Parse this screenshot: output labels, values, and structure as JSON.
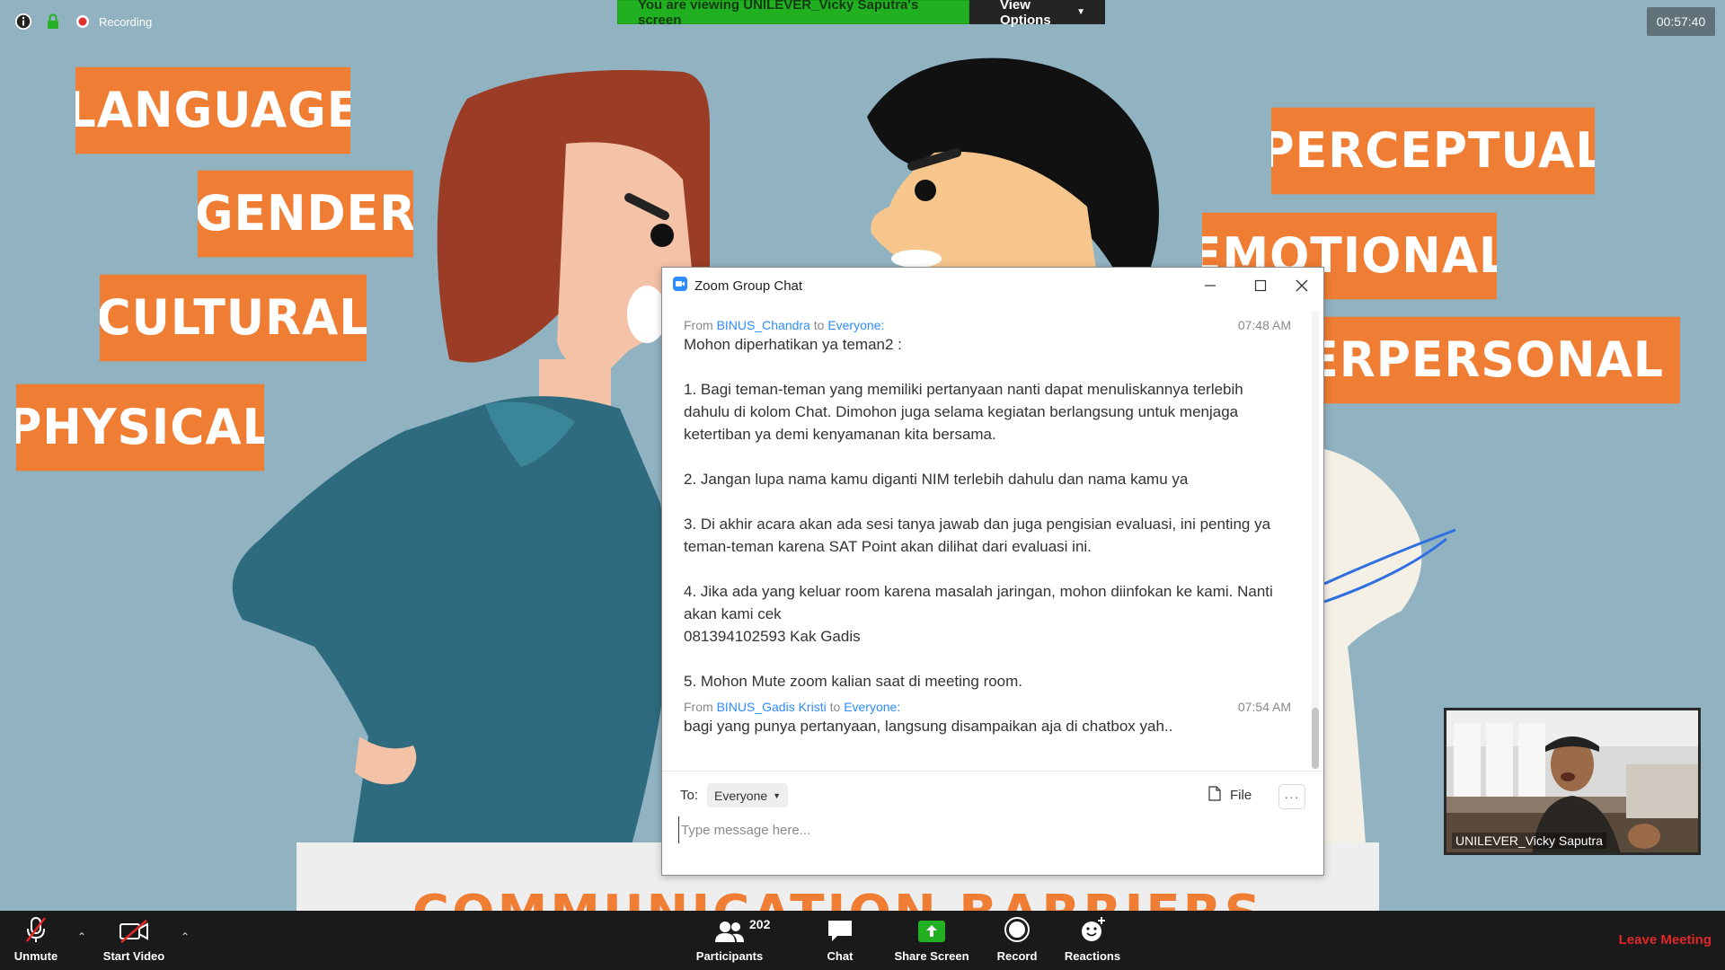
{
  "top_bar": {
    "recording_label": "Recording",
    "viewing_text": "You are viewing UNILEVER_Vicky Saputra's screen",
    "view_options_label": "View Options",
    "timer": "00:57:40"
  },
  "slide": {
    "labels": [
      "LANGUAGE",
      "GENDER",
      "CULTURAL",
      "PHYSICAL",
      "PERCEPTUAL",
      "EMOTIONAL",
      "INTERPERSONAL"
    ],
    "banner": "COMMUNICATION BARRIERS",
    "accent_color": "#ef7d33",
    "background_color": "#90b2c1"
  },
  "chat": {
    "title": "Zoom Group Chat",
    "messages": [
      {
        "from_prefix": "From",
        "sender": "BINUS_Chandra",
        "to_word": "to",
        "recipient": "Everyone:",
        "time": "07:48 AM",
        "body": "Mohon diperhatikan ya teman2 :\n\n1. Bagi teman-teman yang memiliki pertanyaan nanti dapat menuliskannya terlebih dahulu di kolom Chat. Dimohon juga selama kegiatan berlangsung untuk menjaga ketertiban ya demi kenyamanan kita bersama.\n\n2. Jangan lupa nama kamu diganti NIM terlebih dahulu dan nama kamu ya\n\n3. Di akhir acara akan ada sesi tanya jawab dan juga pengisian evaluasi, ini penting ya teman-teman karena SAT Point akan dilihat dari evaluasi ini.\n\n4. Jika ada yang keluar room karena masalah jaringan, mohon diinfokan ke kami. Nanti akan kami cek\n081394102593 Kak Gadis\n\n5. Mohon Mute zoom kalian saat di meeting room."
      },
      {
        "from_prefix": "From",
        "sender": "BINUS_Gadis Kristi",
        "to_word": "to",
        "recipient": "Everyone:",
        "time": "07:54 AM",
        "body": "bagi yang punya pertanyaan, langsung disampaikan aja di chatbox yah.."
      }
    ],
    "to_label": "To:",
    "recipient_select": "Everyone",
    "file_label": "File",
    "input_placeholder": "Type message here..."
  },
  "video": {
    "participant_name": "UNILEVER_Vicky Saputra"
  },
  "toolbar": {
    "unmute_label": "Unmute",
    "start_video_label": "Start Video",
    "participants_label": "Participants",
    "participants_count": "202",
    "chat_label": "Chat",
    "share_screen_label": "Share Screen",
    "record_label": "Record",
    "reactions_label": "Reactions",
    "leave_label": "Leave Meeting"
  }
}
